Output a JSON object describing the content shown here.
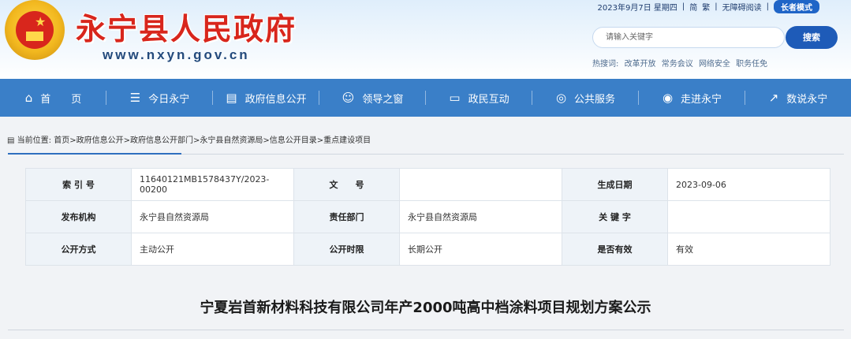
{
  "header": {
    "site_name": "永宁县人民政府",
    "site_url": "www.nxyn.gov.cn",
    "date": "2023年9月7日 星期四",
    "simplified": "简",
    "traditional": "繁",
    "accessible": "无障碍阅读",
    "elder_mode": "长者模式",
    "search_placeholder": "请输入关键字",
    "search_button": "搜索",
    "hot_label": "热搜词:",
    "hot_words": [
      "改革开放",
      "常务会议",
      "网络安全",
      "职务任免"
    ]
  },
  "nav": [
    {
      "label": "首　　页",
      "icon": "home-icon"
    },
    {
      "label": "今日永宁",
      "icon": "list-icon"
    },
    {
      "label": "政府信息公开",
      "icon": "document-icon"
    },
    {
      "label": "领导之窗",
      "icon": "people-icon"
    },
    {
      "label": "政民互动",
      "icon": "chat-icon"
    },
    {
      "label": "公共服务",
      "icon": "compass-icon"
    },
    {
      "label": "走进永宁",
      "icon": "location-icon"
    },
    {
      "label": "数说永宁",
      "icon": "trend-icon"
    }
  ],
  "breadcrumb": {
    "label": "当前位置:",
    "path": "首页>政府信息公开>政府信息公开部门>永宁县自然资源局>信息公开目录>重点建设项目"
  },
  "info": {
    "index_label": "索 引 号",
    "index_value": "11640121MB1578437Y/2023-00200",
    "doc_label": "文　　号",
    "doc_value": "",
    "date_label": "生成日期",
    "date_value": "2023-09-06",
    "publisher_label": "发布机构",
    "publisher_value": "永宁县自然资源局",
    "dept_label": "责任部门",
    "dept_value": "永宁县自然资源局",
    "keyword_label": "关 键 字",
    "keyword_value": "",
    "mode_label": "公开方式",
    "mode_value": "主动公开",
    "time_label": "公开时限",
    "time_value": "长期公开",
    "valid_label": "是否有效",
    "valid_value": "有效"
  },
  "article": {
    "title": "宁夏岩首新材料科技有限公司年产2000吨高中档涂料项目规划方案公示"
  }
}
